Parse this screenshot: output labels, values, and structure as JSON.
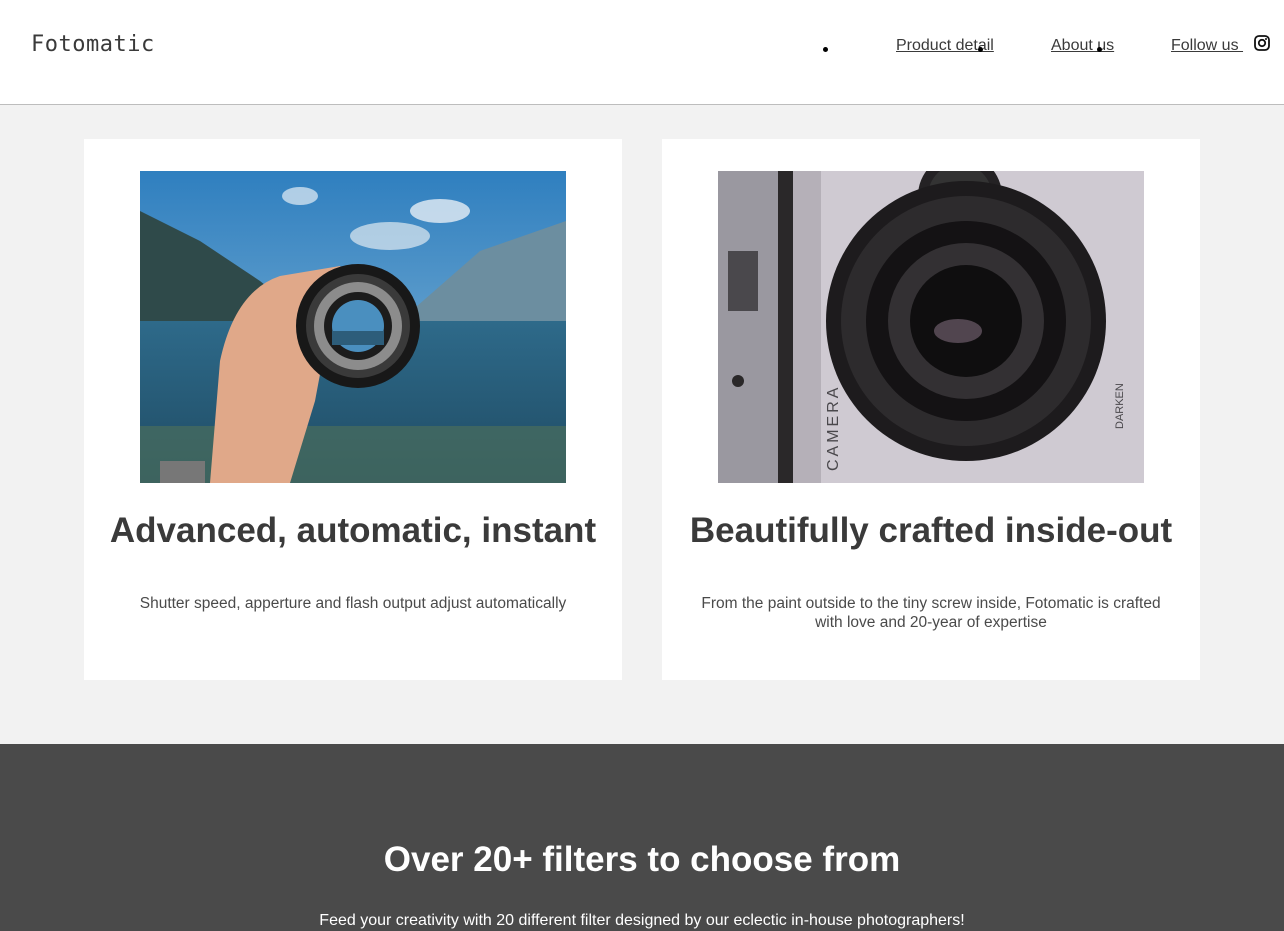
{
  "header": {
    "logo": "Fotomatic",
    "nav": [
      {
        "label": "Product detail"
      },
      {
        "label": "About us"
      },
      {
        "label": "Follow us "
      }
    ],
    "social_icon": "instagram-icon"
  },
  "features": [
    {
      "title": "Advanced, automatic, instant",
      "text": "Shutter speed, apperture and flash output adjust automatically",
      "image": "hand-holding-lens-over-lake"
    },
    {
      "title": "Beautifully crafted inside-out",
      "text": "From the paint outside to the tiny screw inside, Fotomatic is crafted with love and 20-year of expertise",
      "image": "vintage-camera-closeup"
    }
  ],
  "filters": {
    "title": "Over 20+ filters to choose from",
    "text": "Feed your creativity with 20 different filter designed by our eclectic in-house photographers!"
  },
  "colors": {
    "header_bg": "#ffffff",
    "page_bg": "#f2f2f2",
    "dark_section_bg": "#4a4a4a",
    "text": "#3a3a3a"
  }
}
